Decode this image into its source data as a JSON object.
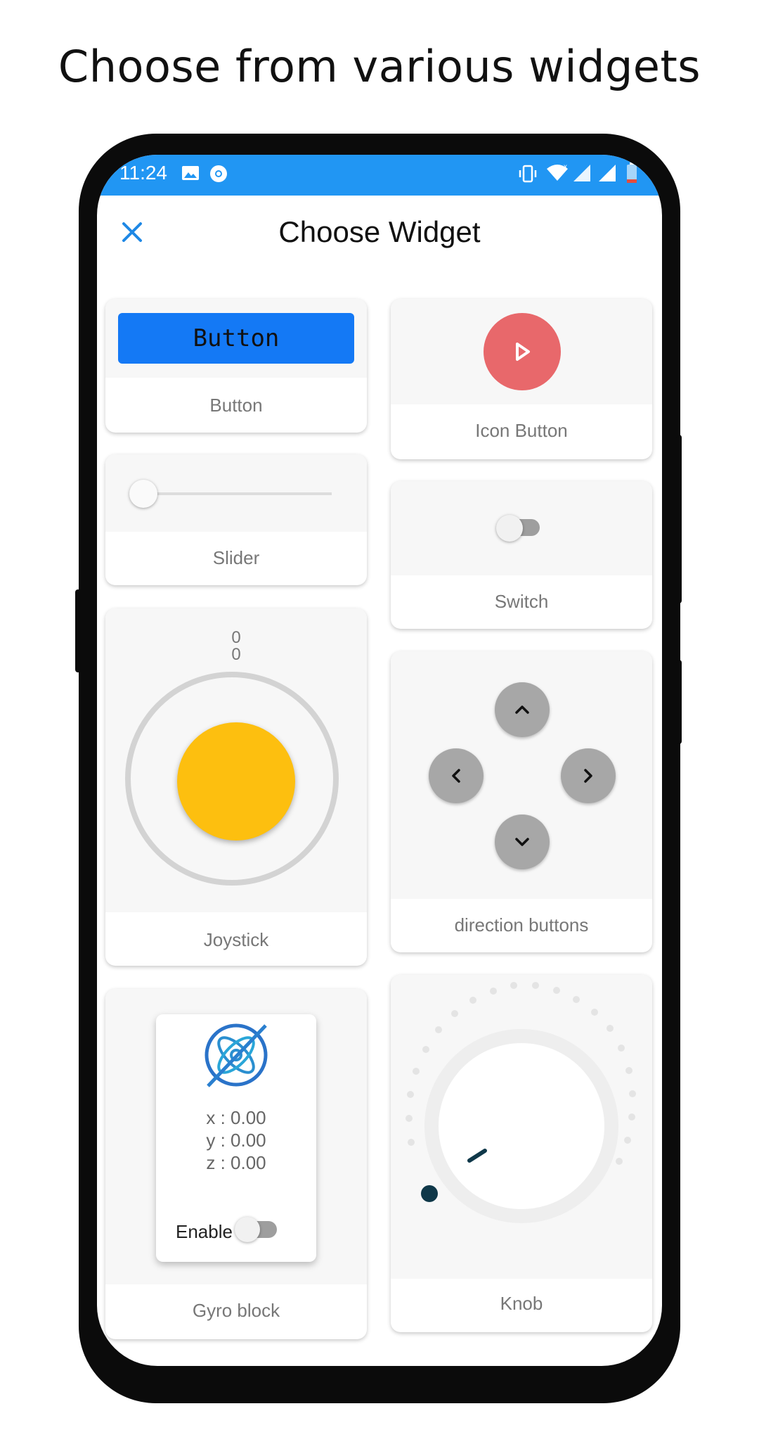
{
  "headline": "Choose from various widgets",
  "status_bar": {
    "time": "11:24",
    "color": "#2196f3"
  },
  "app_bar": {
    "title": "Choose Widget",
    "close_icon": "close-icon"
  },
  "widgets": {
    "button": {
      "preview_text": "Button",
      "label": "Button",
      "color": "#1479f5"
    },
    "icon_button": {
      "label": "Icon Button",
      "color": "#e8686b",
      "icon": "play-icon"
    },
    "slider": {
      "label": "Slider",
      "value": 0
    },
    "switch": {
      "label": "Switch",
      "state": "off"
    },
    "joystick": {
      "x_value": "0",
      "y_value": "0",
      "label": "Joystick",
      "color": "#fdbf0f"
    },
    "direction_buttons": {
      "label": "direction buttons"
    },
    "gyro": {
      "x": "x : 0.00",
      "y": "y : 0.00",
      "z": "z : 0.00",
      "enable_label": "Enable",
      "label": "Gyro block"
    },
    "knob": {
      "label": "Knob",
      "value": 0
    }
  }
}
